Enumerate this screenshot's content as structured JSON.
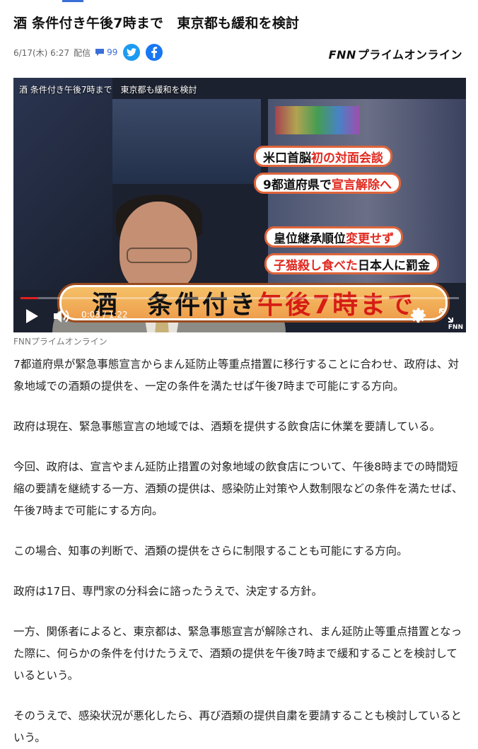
{
  "article": {
    "title": "酒 条件付き午後7時まで　東京都も緩和を検討",
    "date": "6/17(木) 6:27",
    "delivery_label": "配信",
    "comment_count": "99",
    "publisher_logo": "FNNプライムオンライン"
  },
  "video": {
    "overlay_title": "酒 条件付き午後7時まで　東京都も緩和を検討",
    "captions": [
      {
        "plain": "米口首脳 ",
        "red": "初の対面会談",
        "after": ""
      },
      {
        "plain": "9都道府県で",
        "red": "宣言解除へ",
        "after": ""
      },
      {
        "plain": "皇位継承順位",
        "red": "変更せず",
        "after": ""
      },
      {
        "plain": "",
        "red": "子猫殺し食べた",
        "after": "日本人に罰金"
      }
    ],
    "main_caption_plain": "酒　条件付き",
    "main_caption_red": "午後7時まで",
    "time_display": "0:03 / 1:22",
    "progress": 0.04,
    "watermark": "FNN"
  },
  "image_caption": "FNNプライムオンライン",
  "paragraphs": [
    "7都道府県が緊急事態宣言からまん延防止等重点措置に移行することに合わせ、政府は、対象地域での酒類の提供を、一定の条件を満たせば午後7時まで可能にする方向。",
    "政府は現在、緊急事態宣言の地域では、酒類を提供する飲食店に休業を要請している。",
    "今回、政府は、宣言やまん延防止措置の対象地域の飲食店について、午後8時までの時間短縮の要請を継続する一方、酒類の提供は、感染防止対策や人数制限などの条件を満たせば、午後7時まで可能にする方向。",
    "この場合、知事の判断で、酒類の提供をさらに制限することも可能にする方向。",
    "政府は17日、専門家の分科会に諮ったうえで、決定する方針。",
    "一方、関係者によると、東京都は、緊急事態宣言が解除され、まん延防止等重点措置となった際に、何らかの条件を付けたうえで、酒類の提供を午後7時まで緩和することを検討しているという。",
    "そのうえで、感染状況が悪化したら、再び酒類の提供自粛を要請することも検討しているという。"
  ],
  "icons": {
    "comment": "speech-bubble-icon",
    "twitter": "twitter-bird-icon",
    "facebook": "facebook-f-icon",
    "play": "play-icon",
    "volume": "volume-icon",
    "settings": "gear-icon",
    "fullscreen": "fullscreen-icon"
  },
  "colors": {
    "accent_blue": "#3a6fd8",
    "twitter": "#1d9bf0",
    "facebook": "#1877f2",
    "caption_red": "#e0291f",
    "progress_red": "#e02020"
  }
}
